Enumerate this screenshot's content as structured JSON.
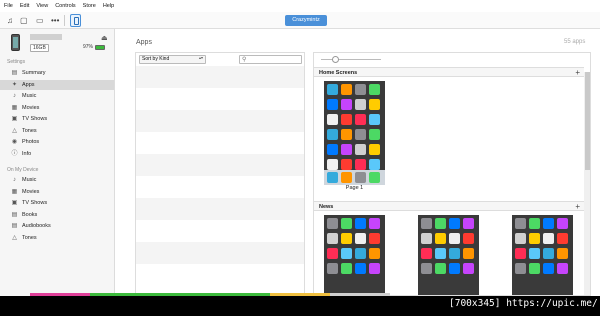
{
  "menu": [
    "File",
    "Edit",
    "View",
    "Controls",
    "Store",
    "Help"
  ],
  "toolbar": {
    "icons": [
      "music-icon",
      "tv-icon",
      "monitor-icon",
      "more-icon",
      "device-icon"
    ],
    "device_name": "Crazymintz"
  },
  "device": {
    "capacity": "16GB",
    "battery": "97%",
    "battery_level": 0.97,
    "battery_color": "#3cba3c"
  },
  "sidebar": {
    "settings_header": "Settings",
    "settings_items": [
      {
        "label": "Summary",
        "icon": "summary-icon"
      },
      {
        "label": "Apps",
        "icon": "apps-icon",
        "selected": true
      },
      {
        "label": "Music",
        "icon": "music-icon"
      },
      {
        "label": "Movies",
        "icon": "movies-icon"
      },
      {
        "label": "TV Shows",
        "icon": "tv-shows-icon"
      },
      {
        "label": "Tones",
        "icon": "bell-icon"
      },
      {
        "label": "Photos",
        "icon": "camera-icon"
      },
      {
        "label": "Info",
        "icon": "info-icon"
      }
    ],
    "ondevice_header": "On My Device",
    "ondevice_items": [
      {
        "label": "Music",
        "icon": "music-icon"
      },
      {
        "label": "Movies",
        "icon": "movies-icon"
      },
      {
        "label": "TV Shows",
        "icon": "tv-shows-icon"
      },
      {
        "label": "Books",
        "icon": "books-icon"
      },
      {
        "label": "Audiobooks",
        "icon": "audiobooks-icon"
      },
      {
        "label": "Tones",
        "icon": "bell-icon"
      }
    ]
  },
  "apps": {
    "title": "Apps",
    "count": "55 apps",
    "sort_label": "Sort by Kind",
    "search_placeholder": ""
  },
  "screens": {
    "home_header": "Home Screens",
    "page1_label": "Page 1",
    "news_header": "News",
    "add_symbol": "+"
  },
  "colors": {
    "accent": "#4a90d9",
    "selection": "#d8d8d8"
  },
  "watermark": "[700x345] https://upic.me/"
}
